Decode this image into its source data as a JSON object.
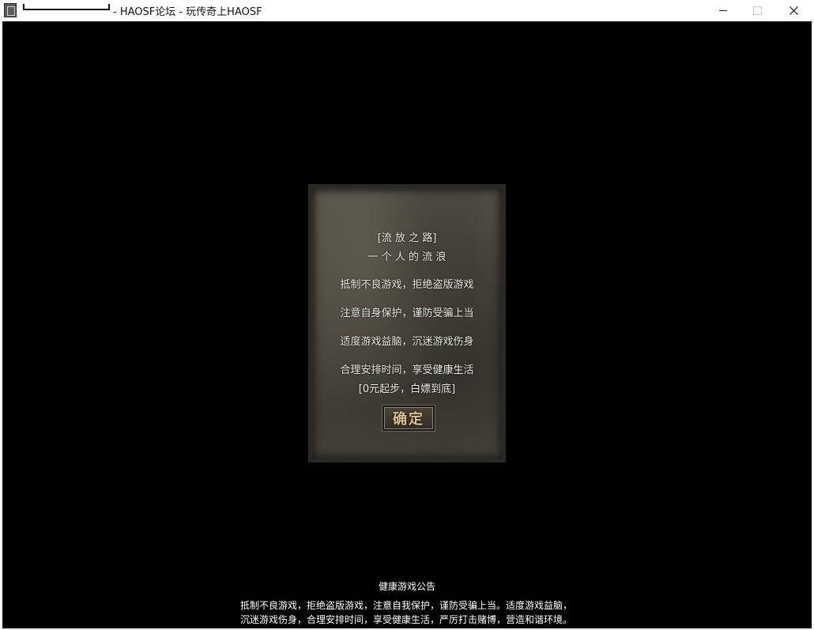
{
  "window": {
    "title": "- HAOSF论坛 - 玩传奇上HAOSF",
    "minimize_glyph": "",
    "close_glyph": ""
  },
  "stone_panel": {
    "line1": "[流 放 之 路]",
    "line2": "一 个 人 的 流 浪",
    "line3": "抵制不良游戏，拒绝盗版游戏",
    "line4": "注意自身保护，谨防受骗上当",
    "line5": "适度游戏益脑，沉迷游戏伤身",
    "line6": "合理安排时间，享受健康生活",
    "line7": "[0元起步，白嫖到底]",
    "confirm_label": "确定"
  },
  "announcement": {
    "title": "健康游戏公告",
    "line1": "抵制不良游戏，拒绝盗版游戏，注意自我保护，谨防受骗上当。适度游戏益脑，",
    "line2": "沉迷游戏伤身，合理安排时间，享受健康生活，严厉打击赌博，营造和谐环境。"
  }
}
